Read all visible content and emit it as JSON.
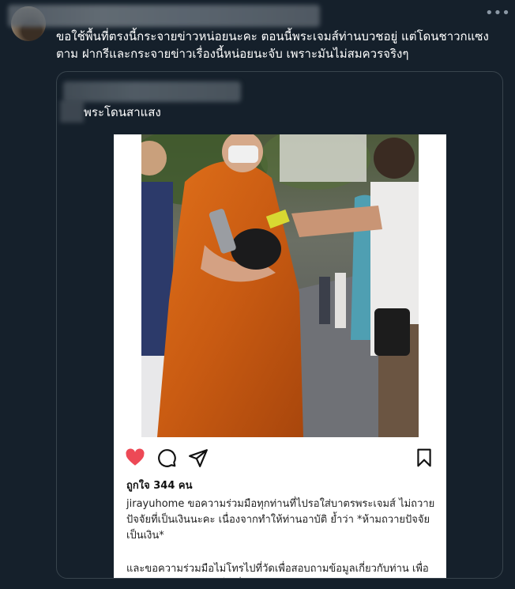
{
  "tweet": {
    "text": "ขอใช้พื้นที่ตรงนี้กระจายข่าวหน่อยนะคะ ตอนนี้พระเจมส์ท่านบวชอยู่ แต่โดนชาวกแซง ตาม ฝากรีและกระจายข่าวเรื่องนี้หน่อยนะจับ เพราะมันไม่สมควรจริงๆ",
    "more_icon": "more-horizontal-icon"
  },
  "quote": {
    "text": "พระโดนสาแสง",
    "post": {
      "likes": "ถูกใจ 344 คน",
      "caption_paragraph_1": "jirayuhome ขอความร่วมมือทุกท่านที่ไปรอใส่บาตรพระเจมส์ ไม่ถวายปัจจัยที่เป็นเงินนะคะ เนื่องจากทำให้ท่านอาบัติ ย้ำว่า *ห้ามถวายปัจจัยเป็นเงิน*",
      "caption_paragraph_2": "และขอความร่วมมือไม่โทรไปที่วัดเพื่อสอบถามข้อมูลเกี่ยวกับท่าน เพื่อไม่ให้เกิดปัญหา และเป็นเรื่องการรบกวนการดำเนินชีวิตของท่าน",
      "icons": [
        "heart-icon",
        "comment-icon",
        "share-icon",
        "bookmark-icon"
      ],
      "heart_color": "#ed4956"
    }
  }
}
